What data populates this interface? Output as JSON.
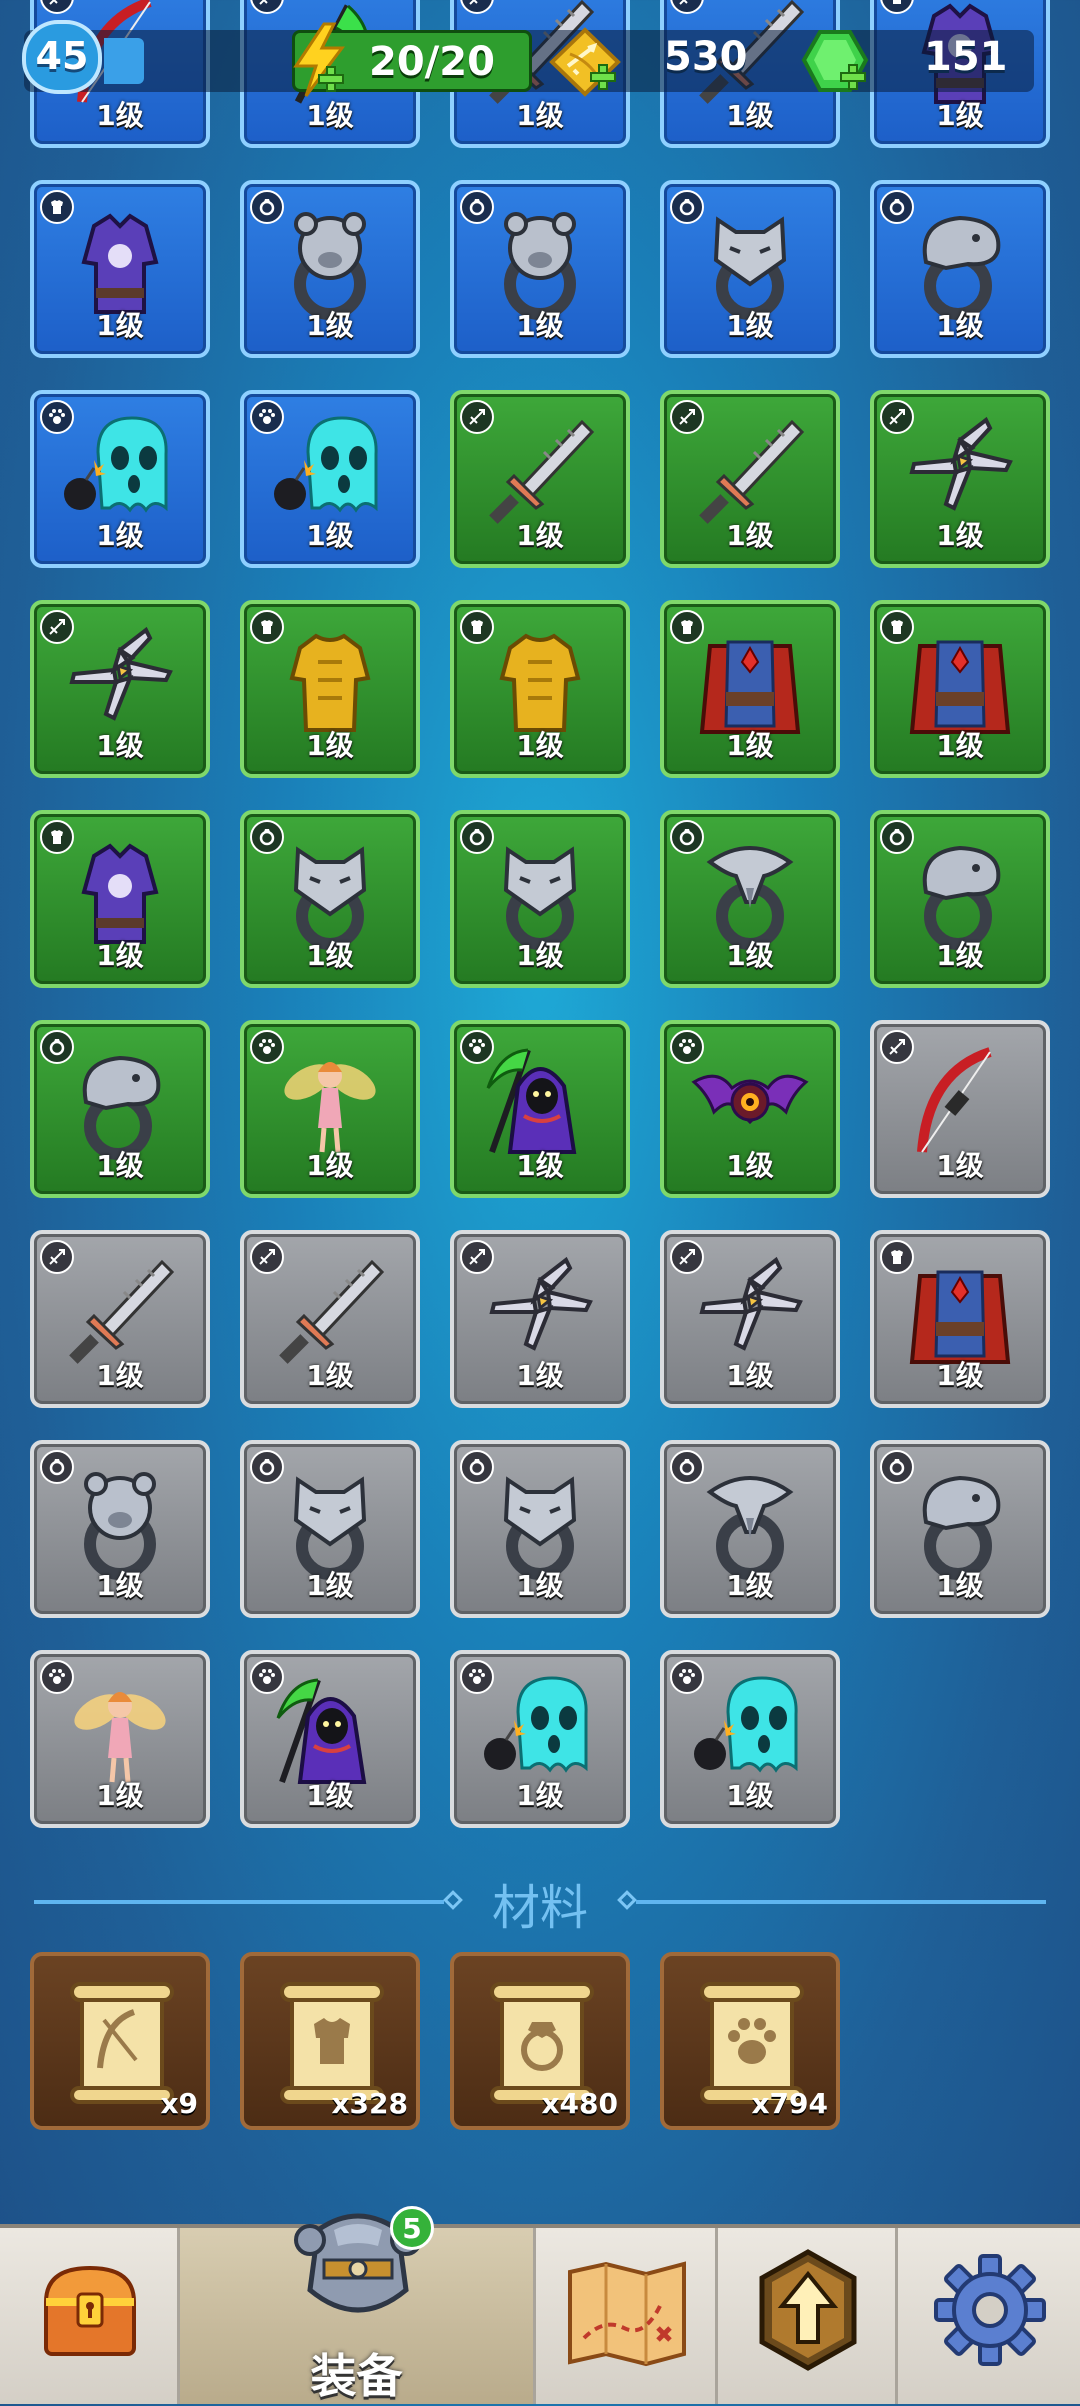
{
  "hud": {
    "level": "45",
    "energy": "20/20",
    "coins": "530",
    "gems": "151"
  },
  "grid_rows": [
    [
      "weapon",
      "weapon",
      "weapon",
      "weapon",
      "armor"
    ],
    [
      "armor",
      "ring",
      "ring",
      "ring",
      "ring"
    ],
    [
      "pet",
      "pet",
      "weapon",
      "weapon",
      "weapon"
    ],
    [
      "weapon",
      "armor",
      "armor",
      "armor",
      "armor"
    ],
    [
      "armor",
      "ring",
      "ring",
      "ring",
      "ring"
    ],
    [
      "ring",
      "pet",
      "pet",
      "pet",
      "weapon"
    ],
    [
      "weapon",
      "weapon",
      "weapon",
      "weapon",
      "armor"
    ],
    [
      "ring",
      "ring",
      "ring",
      "ring",
      "ring"
    ],
    [
      "pet",
      "pet",
      "pet",
      "pet"
    ]
  ],
  "items": [
    {
      "type": "weapon",
      "art": "bow",
      "rarity": "blue",
      "level": "1级"
    },
    {
      "type": "weapon",
      "art": "scythe",
      "rarity": "blue",
      "level": "1级"
    },
    {
      "type": "weapon",
      "art": "sword",
      "rarity": "blue",
      "level": "1级"
    },
    {
      "type": "weapon",
      "art": "sword",
      "rarity": "blue",
      "level": "1级"
    },
    {
      "type": "armor",
      "art": "robe-purple",
      "rarity": "blue",
      "level": "1级"
    },
    {
      "type": "armor",
      "art": "robe-purple",
      "rarity": "blue",
      "level": "1级"
    },
    {
      "type": "ring",
      "art": "ring-bear",
      "rarity": "blue",
      "level": "1级"
    },
    {
      "type": "ring",
      "art": "ring-bear",
      "rarity": "blue",
      "level": "1级"
    },
    {
      "type": "ring",
      "art": "ring-wolf",
      "rarity": "blue",
      "level": "1级"
    },
    {
      "type": "ring",
      "art": "ring-snake",
      "rarity": "blue",
      "level": "1级"
    },
    {
      "type": "pet",
      "art": "ghost",
      "rarity": "blue",
      "level": "1级"
    },
    {
      "type": "pet",
      "art": "ghost",
      "rarity": "blue",
      "level": "1级"
    },
    {
      "type": "weapon",
      "art": "sword",
      "rarity": "green",
      "level": "1级"
    },
    {
      "type": "weapon",
      "art": "sword",
      "rarity": "green",
      "level": "1级"
    },
    {
      "type": "weapon",
      "art": "shuriken",
      "rarity": "green",
      "level": "1级"
    },
    {
      "type": "weapon",
      "art": "shuriken",
      "rarity": "green",
      "level": "1级"
    },
    {
      "type": "armor",
      "art": "armor-gold",
      "rarity": "green",
      "level": "1级"
    },
    {
      "type": "armor",
      "art": "armor-gold",
      "rarity": "green",
      "level": "1级"
    },
    {
      "type": "armor",
      "art": "cape-red",
      "rarity": "green",
      "level": "1级"
    },
    {
      "type": "armor",
      "art": "cape-red",
      "rarity": "green",
      "level": "1级"
    },
    {
      "type": "armor",
      "art": "robe-purple",
      "rarity": "green",
      "level": "1级"
    },
    {
      "type": "ring",
      "art": "ring-wolf",
      "rarity": "green",
      "level": "1级"
    },
    {
      "type": "ring",
      "art": "ring-wolf",
      "rarity": "green",
      "level": "1级"
    },
    {
      "type": "ring",
      "art": "ring-eagle",
      "rarity": "green",
      "level": "1级"
    },
    {
      "type": "ring",
      "art": "ring-snake",
      "rarity": "green",
      "level": "1级"
    },
    {
      "type": "ring",
      "art": "ring-snake",
      "rarity": "green",
      "level": "1级"
    },
    {
      "type": "pet",
      "art": "fairy",
      "rarity": "green",
      "level": "1级"
    },
    {
      "type": "pet",
      "art": "reaper",
      "rarity": "green",
      "level": "1级"
    },
    {
      "type": "pet",
      "art": "bat",
      "rarity": "green",
      "level": "1级"
    },
    {
      "type": "weapon",
      "art": "bow",
      "rarity": "gray",
      "level": "1级"
    },
    {
      "type": "weapon",
      "art": "sword",
      "rarity": "gray",
      "level": "1级"
    },
    {
      "type": "weapon",
      "art": "sword",
      "rarity": "gray",
      "level": "1级"
    },
    {
      "type": "weapon",
      "art": "shuriken",
      "rarity": "gray",
      "level": "1级"
    },
    {
      "type": "weapon",
      "art": "shuriken",
      "rarity": "gray",
      "level": "1级"
    },
    {
      "type": "armor",
      "art": "cape-red",
      "rarity": "gray",
      "level": "1级"
    },
    {
      "type": "ring",
      "art": "ring-bear",
      "rarity": "gray",
      "level": "1级"
    },
    {
      "type": "ring",
      "art": "ring-wolf",
      "rarity": "gray",
      "level": "1级"
    },
    {
      "type": "ring",
      "art": "ring-wolf",
      "rarity": "gray",
      "level": "1级"
    },
    {
      "type": "ring",
      "art": "ring-eagle",
      "rarity": "gray",
      "level": "1级"
    },
    {
      "type": "ring",
      "art": "ring-snake",
      "rarity": "gray",
      "level": "1级"
    },
    {
      "type": "pet",
      "art": "fairy",
      "rarity": "gray",
      "level": "1级"
    },
    {
      "type": "pet",
      "art": "reaper",
      "rarity": "gray",
      "level": "1级"
    },
    {
      "type": "pet",
      "art": "ghost",
      "rarity": "gray",
      "level": "1级"
    },
    {
      "type": "pet",
      "art": "ghost",
      "rarity": "gray",
      "level": "1级"
    }
  ],
  "materials": {
    "title": "材料",
    "items": [
      {
        "icon": "bow-icon",
        "count": "x9"
      },
      {
        "icon": "armor-icon",
        "count": "x328"
      },
      {
        "icon": "ring-icon",
        "count": "x480"
      },
      {
        "icon": "paw-icon",
        "count": "x794"
      }
    ]
  },
  "nav": {
    "equipment_label": "装备",
    "equipment_badge": "5"
  },
  "colors": {
    "rarity_blue": "#2f7fe3",
    "rarity_green": "#3ea83a",
    "rarity_gray": "#9a9da2",
    "material_bg": "#5c3a1d"
  }
}
